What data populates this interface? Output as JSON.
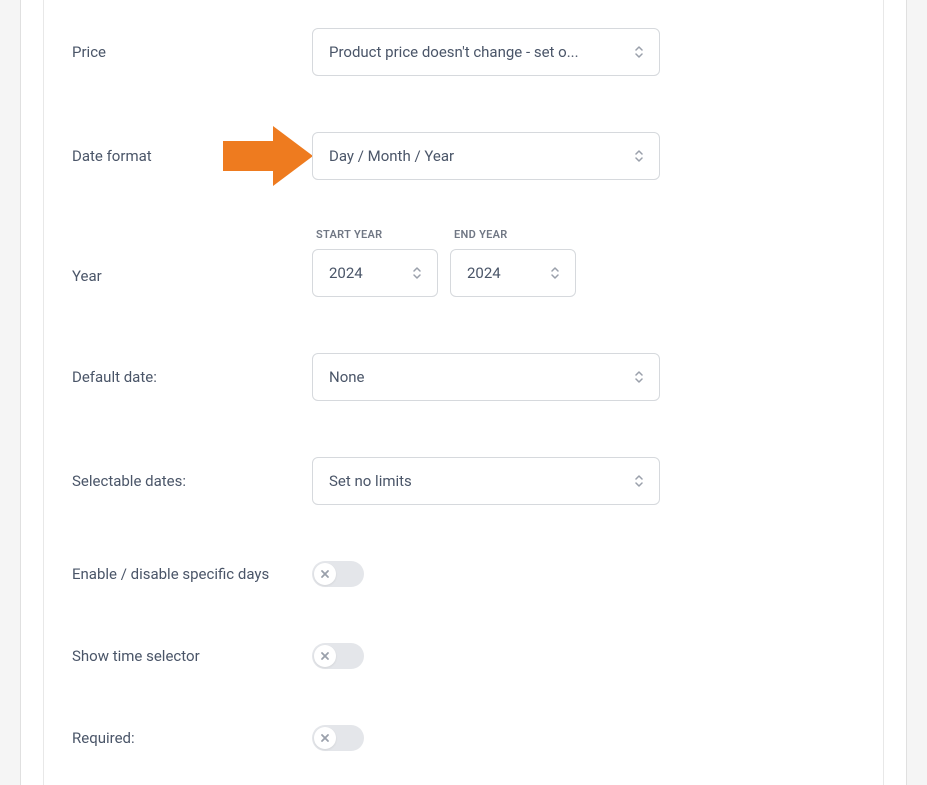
{
  "fields": {
    "price": {
      "label": "Price",
      "value": "Product price doesn't change - set o..."
    },
    "dateFormat": {
      "label": "Date format",
      "value": "Day / Month / Year"
    },
    "year": {
      "label": "Year",
      "startLabel": "START YEAR",
      "startValue": "2024",
      "endLabel": "END YEAR",
      "endValue": "2024"
    },
    "defaultDate": {
      "label": "Default date:",
      "value": "None"
    },
    "selectableDates": {
      "label": "Selectable dates:",
      "value": "Set no limits"
    },
    "specificDays": {
      "label": "Enable / disable specific days",
      "enabled": false
    },
    "timeSelect": {
      "label": "Show time selector",
      "enabled": false
    },
    "required": {
      "label": "Required:",
      "enabled": false
    }
  },
  "colors": {
    "arrow": "#ee7b1f",
    "text": "#4a5568",
    "border": "#d6d9dd",
    "subLabel": "#707784",
    "toggleBg": "#e4e6ea",
    "iconGray": "#9aa0ab"
  }
}
